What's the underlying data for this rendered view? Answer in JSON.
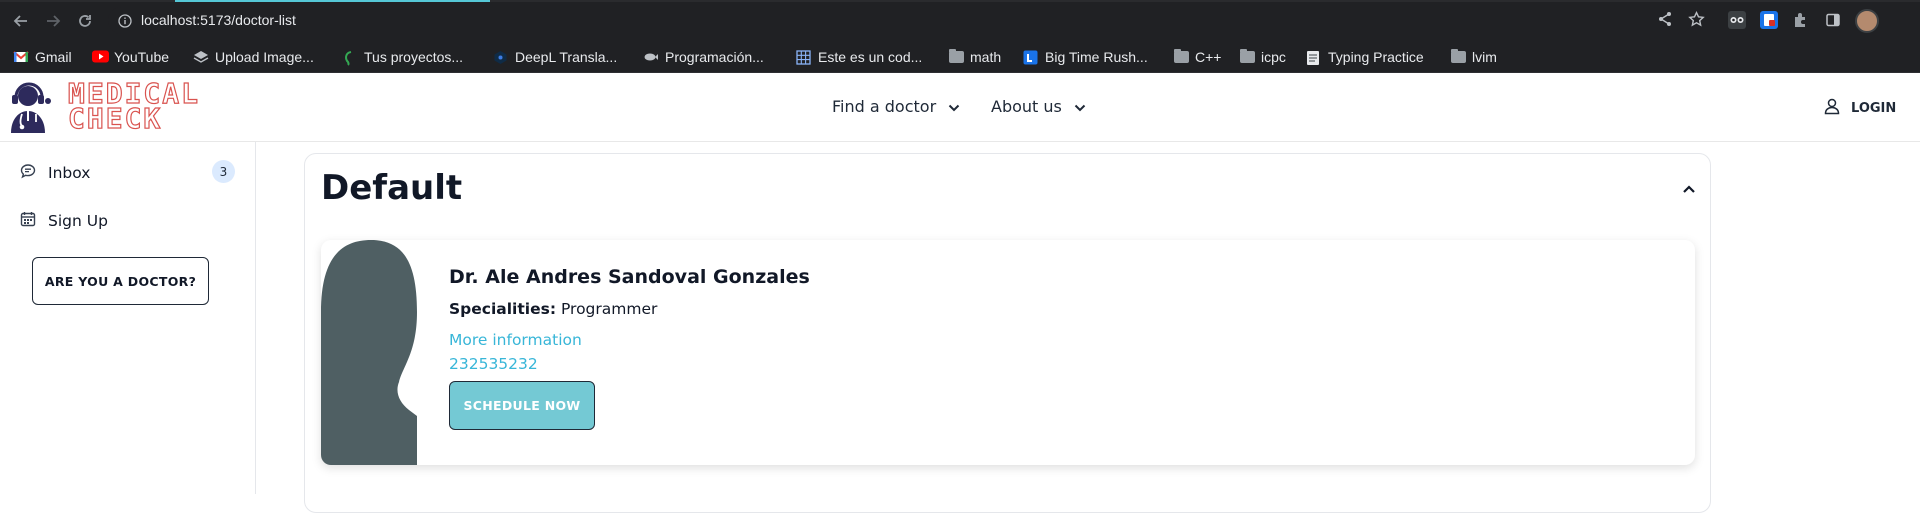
{
  "browser": {
    "url": "localhost:5173/doctor-list",
    "bookmarks": [
      {
        "label": "Gmail",
        "icon": "gmail-icon"
      },
      {
        "label": "YouTube",
        "icon": "youtube-icon"
      },
      {
        "label": "Upload Image...",
        "icon": "upload-icon"
      },
      {
        "label": "Tus proyectos...",
        "icon": "leaf-icon"
      },
      {
        "label": "DeepL Transla...",
        "icon": "deepl-icon"
      },
      {
        "label": "Programación...",
        "icon": "fish-icon"
      },
      {
        "label": "Este es un cod...",
        "icon": "grid-icon"
      },
      {
        "label": "math",
        "icon": "folder-icon"
      },
      {
        "label": "Big Time Rush...",
        "icon": "tv-icon"
      },
      {
        "label": "C++",
        "icon": "folder-icon"
      },
      {
        "label": "icpc",
        "icon": "folder-icon"
      },
      {
        "label": "Typing Practice",
        "icon": "doc-icon"
      },
      {
        "label": "lvim",
        "icon": "folder-icon"
      }
    ]
  },
  "header": {
    "logo_line1": "MEDICAL",
    "logo_line2": "CHECK",
    "nav": [
      {
        "label": "Find a doctor"
      },
      {
        "label": "About us"
      }
    ],
    "login_label": "LOGIN"
  },
  "sidebar": {
    "items": [
      {
        "label": "Inbox",
        "badge": "3",
        "icon": "chat-icon"
      },
      {
        "label": "Sign Up",
        "icon": "calendar-icon"
      }
    ],
    "doctor_button": "ARE YOU A DOCTOR?"
  },
  "main": {
    "section_title": "Default",
    "doctor": {
      "name": "Dr. Ale Andres Sandoval Gonzales",
      "specialities_label": "Specialities:",
      "specialities_value": "Programmer",
      "more_info": "More information",
      "phone": "232535232",
      "schedule_label": "SCHEDULE NOW"
    }
  },
  "colors": {
    "accent": "#74c9d4",
    "link": "#38b6d8",
    "logo": "#d9534f",
    "avatar": "#4f5f63"
  }
}
